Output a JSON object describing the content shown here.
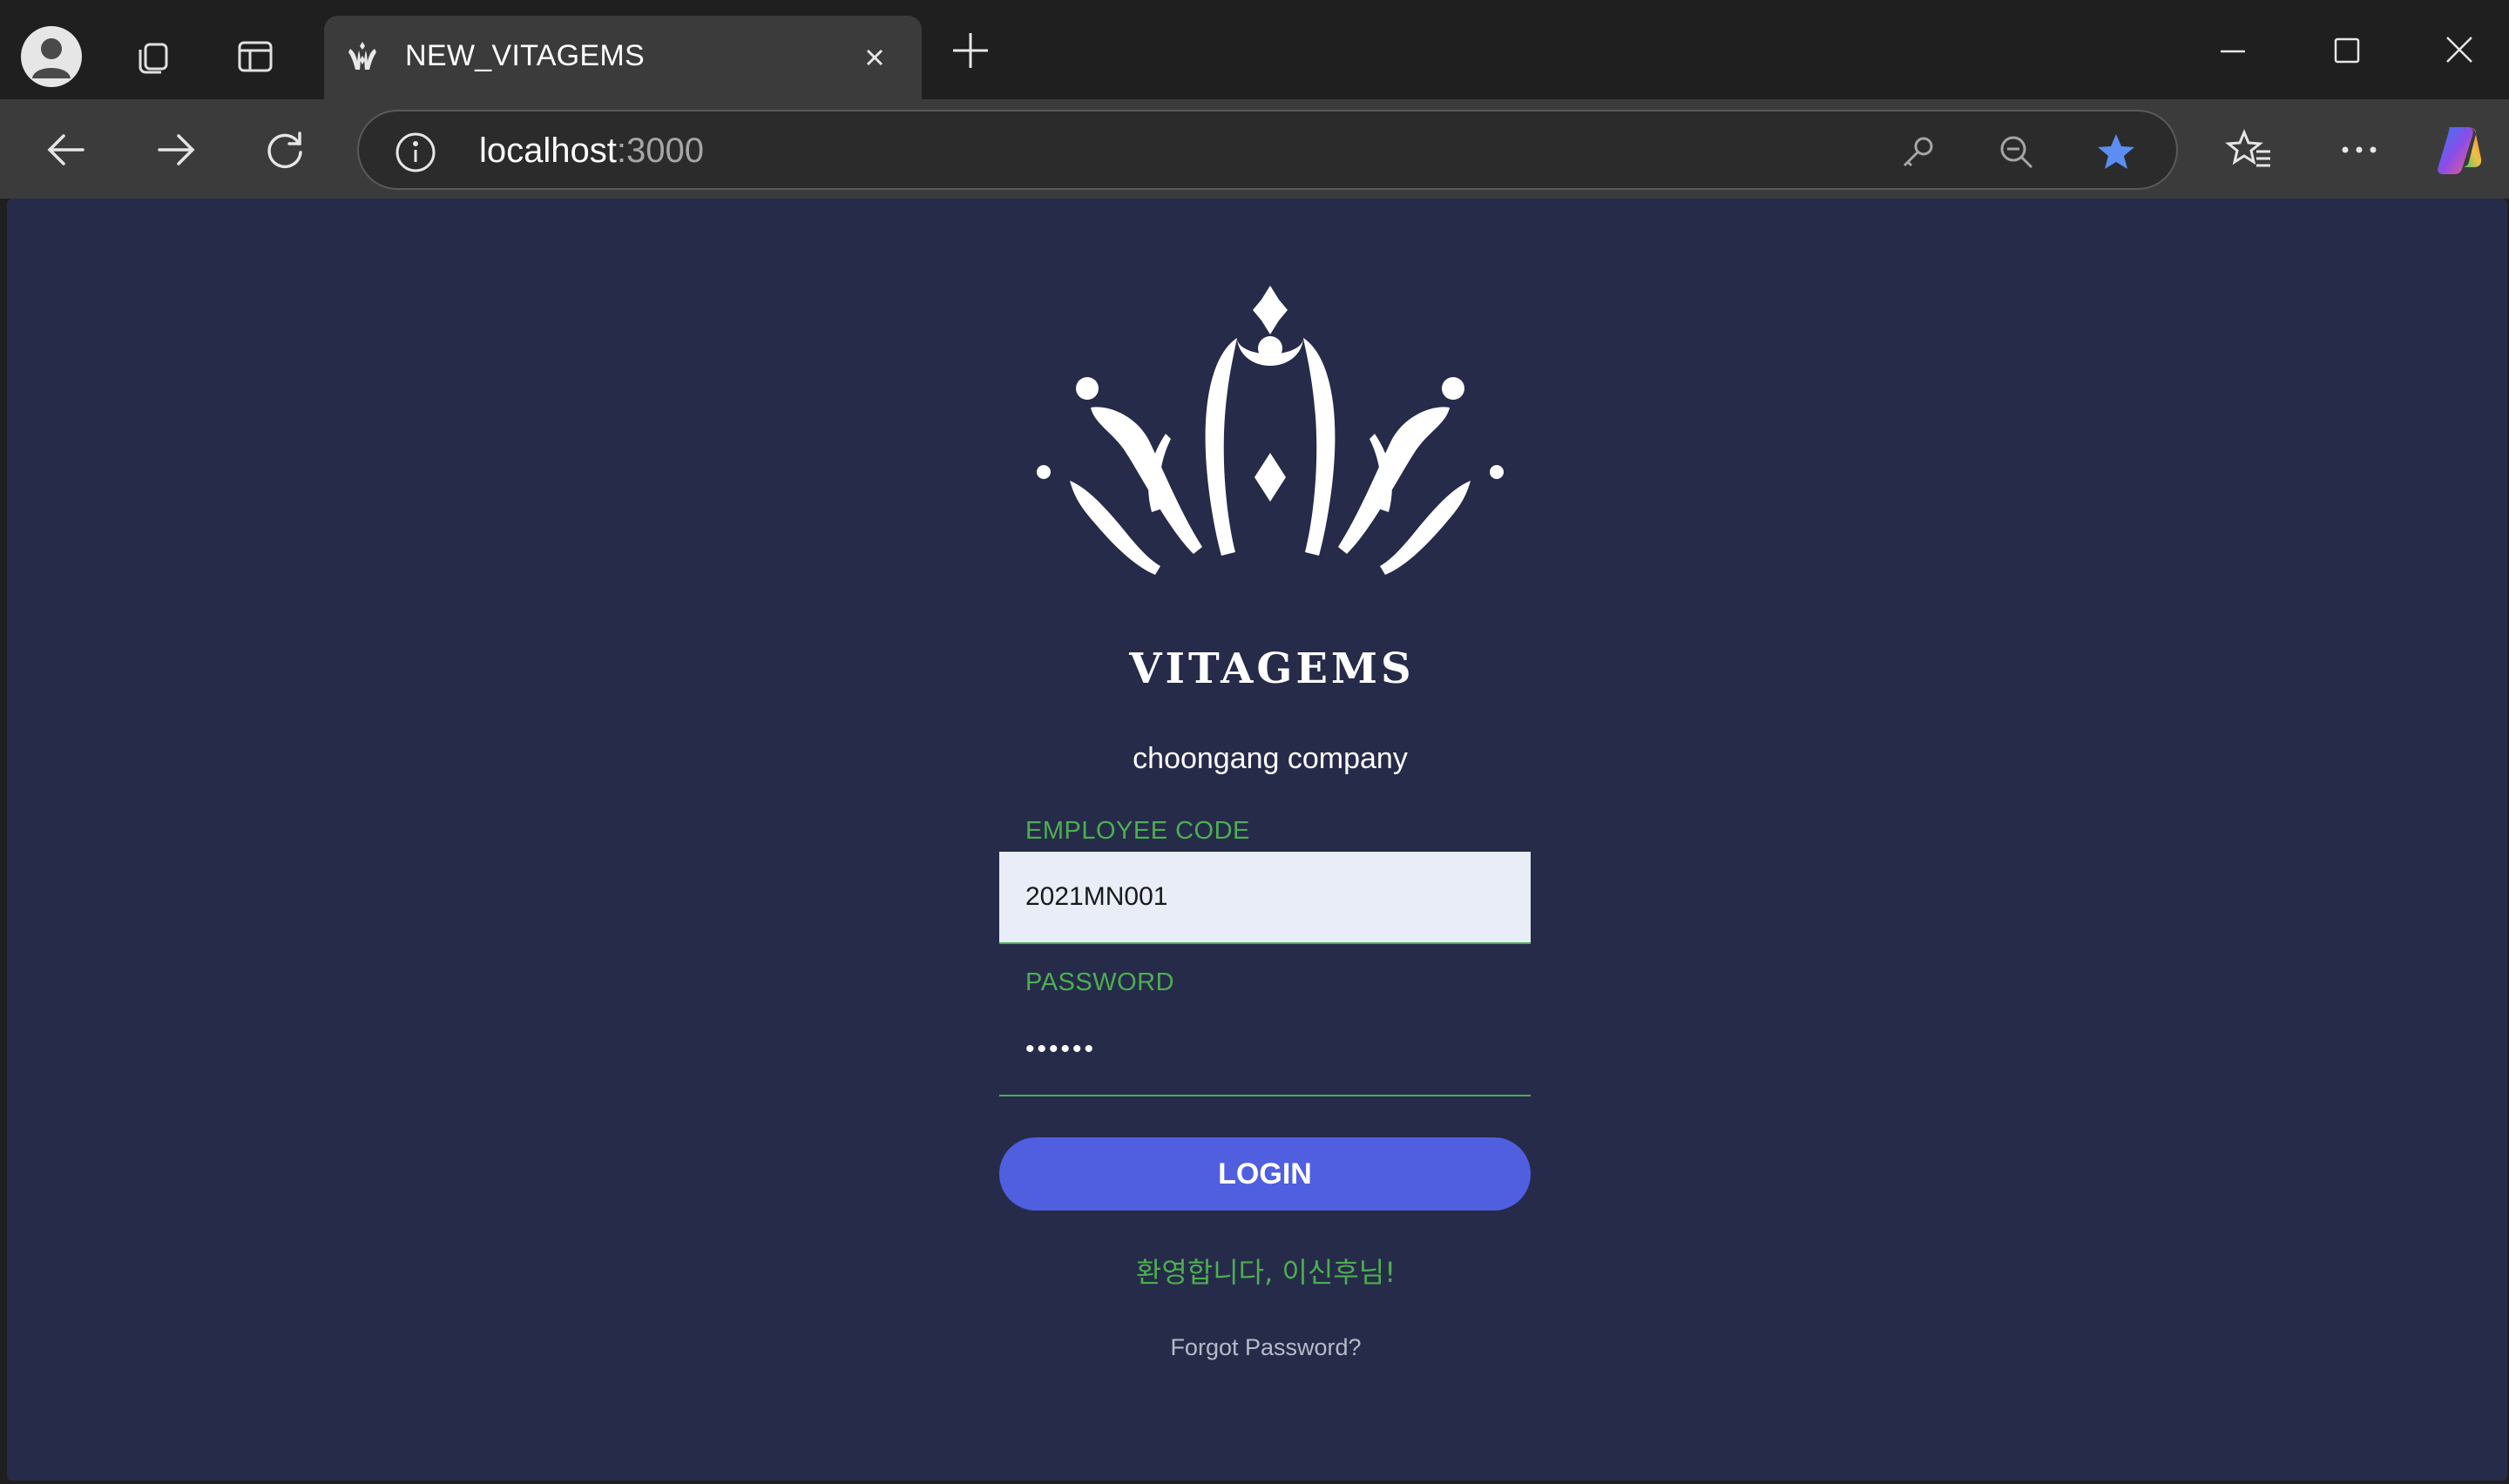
{
  "browser": {
    "tab_title": "NEW_VITAGEMS",
    "url_host": "localhost",
    "url_port": ":3000"
  },
  "login": {
    "brand": "VITAGEMS",
    "company": "choongang company",
    "employee_code_label": "EMPLOYEE CODE",
    "employee_code_value": "2021MN001",
    "password_label": "PASSWORD",
    "password_value": "••••••",
    "login_button": "LOGIN",
    "welcome_message": "환영합니다, 이신후님!",
    "forgot_password": "Forgot Password?"
  },
  "colors": {
    "page_background": "#262b4a",
    "accent_green": "#4caf50",
    "login_button": "#4f5fe0"
  }
}
